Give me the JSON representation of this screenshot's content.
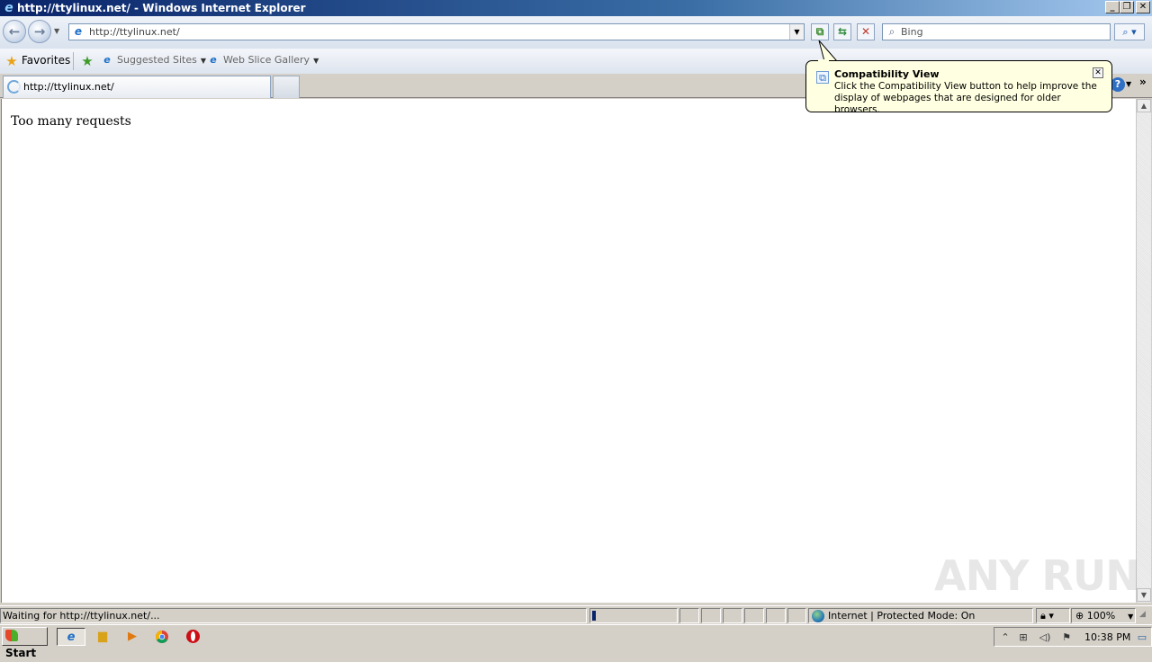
{
  "window": {
    "title": "http://ttylinux.net/ - Windows Internet Explorer",
    "minimize": "_",
    "maximize": "❐",
    "close": "✕"
  },
  "nav": {
    "back_icon": "back-arrow-icon",
    "forward_icon": "forward-arrow-icon",
    "address": "http://ttylinux.net/",
    "dropdown": "▼",
    "compat_icon": "compatibility-view-icon",
    "refresh_icon": "refresh-icon",
    "stop_icon": "stop-icon",
    "search_placeholder": "Bing",
    "search_button_icon": "search-icon"
  },
  "favorites": {
    "label": "Favorites",
    "items": [
      {
        "label": "Suggested Sites"
      },
      {
        "label": "Web Slice Gallery"
      }
    ]
  },
  "tabs": [
    {
      "label": "http://ttylinux.net/",
      "state": "loading"
    }
  ],
  "content": {
    "message": "Too many requests"
  },
  "balloon": {
    "title": "Compatibility View",
    "body": "Click the Compatibility View button to help improve the display of webpages that are designed for older browsers."
  },
  "watermark": "ANY RUN",
  "status": {
    "text": "Waiting for http://ttylinux.net/...",
    "zone": "Internet | Protected Mode: On",
    "zoom": "100%"
  },
  "taskbar": {
    "start": "Start",
    "clock": "10:38 PM"
  },
  "colors": {
    "titlebar_start": "#0a246a",
    "balloon_bg": "#ffffe1",
    "chrome": "#d4d0c8"
  }
}
